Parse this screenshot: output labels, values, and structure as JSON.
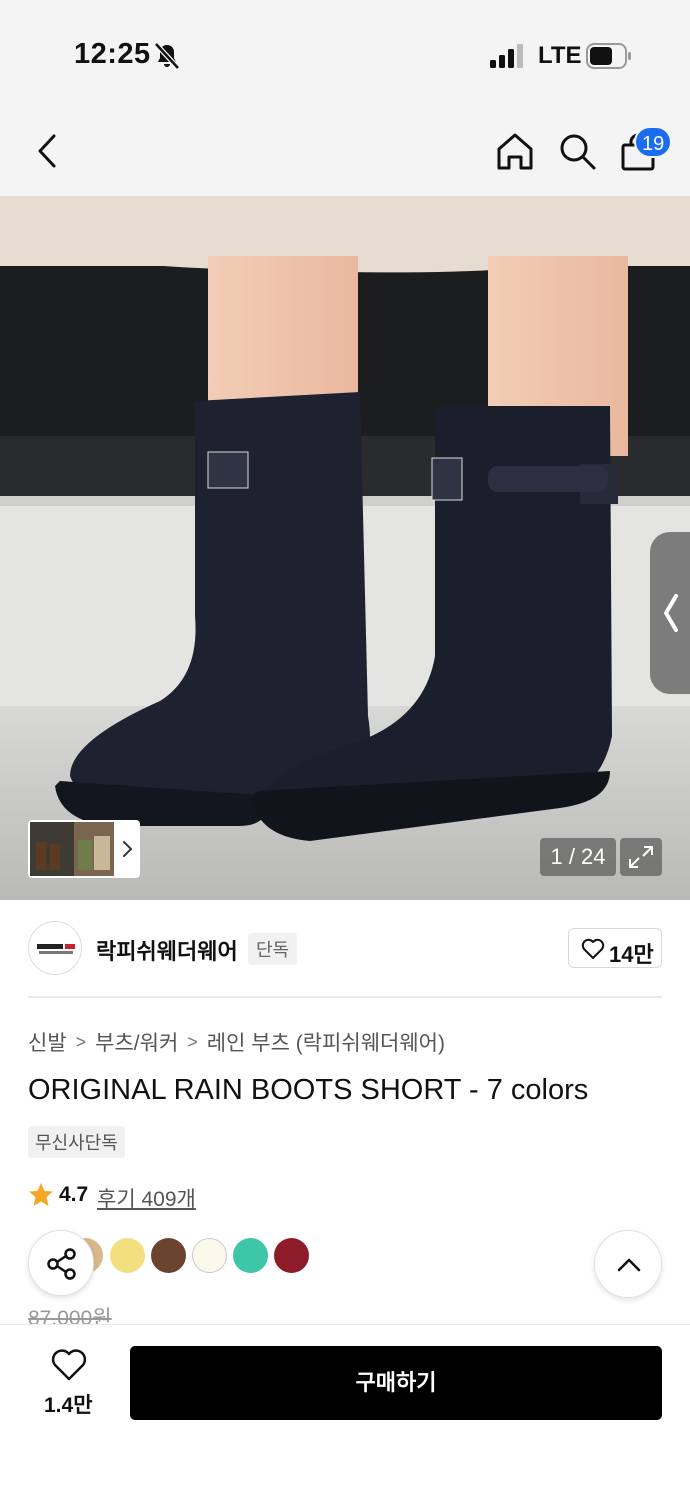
{
  "status_bar": {
    "time": "12:25",
    "network": "LTE"
  },
  "header": {
    "cart_badge": "19"
  },
  "gallery": {
    "counter": "1 / 24"
  },
  "brand": {
    "name": "락피쉬웨더웨어",
    "tag": "단독",
    "like_count": "14만"
  },
  "breadcrumb": [
    "신발",
    "부츠/워커",
    "레인 부츠 (락피쉬웨더웨어)"
  ],
  "product": {
    "title": "ORIGINAL RAIN BOOTS SHORT - 7 colors",
    "tag": "무신사단독",
    "rating": "4.7",
    "review_link": "후기 409개",
    "original_price": "87,000원"
  },
  "colors": [
    "#2b2b2b",
    "#d9b98a",
    "#f2df7e",
    "#6b4430",
    "#fbf9ec",
    "#3ec6a8",
    "#8e1c28"
  ],
  "bottom_bar": {
    "wish_count": "1.4만",
    "buy_label": "구매하기"
  },
  "accent": {
    "badge_blue": "#1a6cf0",
    "star": "#f5a623",
    "button": "#000000"
  },
  "icons": [
    "bell-slash-icon",
    "signal-icon",
    "battery-icon",
    "back-arrow-icon",
    "home-icon",
    "search-icon",
    "shopping-bag-icon",
    "expand-icon",
    "heart-icon",
    "star-icon",
    "share-icon",
    "chevron-up-icon"
  ]
}
